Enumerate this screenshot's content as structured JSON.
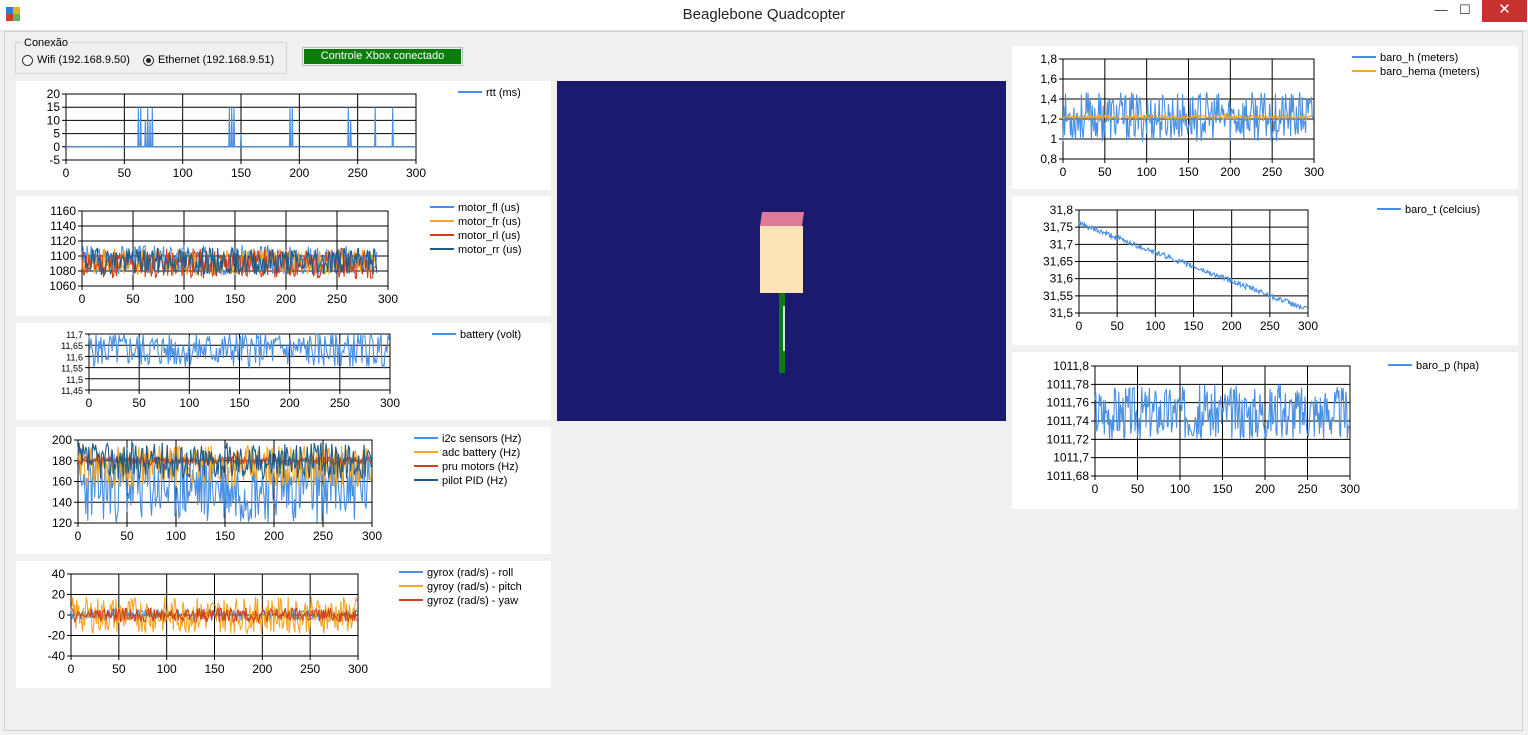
{
  "window": {
    "title": "Beaglebone Quadcopter",
    "minimize_label": "—",
    "maximize_label": "☐",
    "close_label": "✕"
  },
  "connection": {
    "group_label": "Conexão",
    "options": [
      {
        "label": "Wifi (192.168.9.50)",
        "selected": false
      },
      {
        "label": "Ethernet (192.168.9.51)",
        "selected": true
      }
    ]
  },
  "xbox_status": {
    "label": "Controle Xbox conectado",
    "color": "#0a7d0a"
  },
  "colors": {
    "blue": "#4a90e2",
    "orange": "#f5a623",
    "red": "#d0421b",
    "navy": "#1f5c8a"
  },
  "charts": [
    {
      "id": "rtt",
      "x_ticks": [
        "0",
        "50",
        "100",
        "150",
        "200",
        "250",
        "300"
      ],
      "y_ticks": [
        "20",
        "15",
        "10",
        "5",
        "0",
        "-5"
      ],
      "ylim": [
        -5,
        20
      ],
      "legend": [
        "rtt (ms)"
      ],
      "series": [
        {
          "name": "rtt (ms)",
          "color": "#4a90e2",
          "kind": "spikes",
          "base": 0,
          "spikes": [
            [
              62,
              15
            ],
            [
              64,
              15
            ],
            [
              68,
              10
            ],
            [
              70,
              15
            ],
            [
              72,
              10
            ],
            [
              74,
              15
            ],
            [
              140,
              15
            ],
            [
              142,
              15
            ],
            [
              144,
              15
            ],
            [
              150,
              5
            ],
            [
              192,
              15
            ],
            [
              194,
              15
            ],
            [
              242,
              15
            ],
            [
              244,
              10
            ],
            [
              265,
              15
            ],
            [
              280,
              15
            ]
          ]
        }
      ]
    },
    {
      "id": "motors",
      "x_ticks": [
        "0",
        "50",
        "100",
        "150",
        "200",
        "250",
        "300"
      ],
      "y_ticks": [
        "1160",
        "1140",
        "1120",
        "1100",
        "1080",
        "1060"
      ],
      "ylim": [
        1060,
        1160
      ],
      "legend": [
        "motor_fl (us)",
        "motor_fr (us)",
        "motor_rl (us)",
        "motor_rr (us)"
      ],
      "series": [
        {
          "name": "motor_fl (us)",
          "color": "#4a90e2",
          "kind": "noise",
          "mean": 1095,
          "amp": 20,
          "seed": 3,
          "n": 290
        },
        {
          "name": "motor_fr (us)",
          "color": "#f5a623",
          "kind": "noise",
          "mean": 1092,
          "amp": 18,
          "seed": 7,
          "n": 290
        },
        {
          "name": "motor_rl (us)",
          "color": "#d0421b",
          "kind": "noise",
          "mean": 1090,
          "amp": 20,
          "seed": 11,
          "n": 290
        },
        {
          "name": "motor_rr (us)",
          "color": "#1f5c8a",
          "kind": "noise",
          "mean": 1093,
          "amp": 18,
          "seed": 19,
          "n": 290
        }
      ]
    },
    {
      "id": "battery",
      "x_ticks": [
        "0",
        "50",
        "100",
        "150",
        "200",
        "250",
        "300"
      ],
      "y_ticks": [
        "11,7",
        "11,65",
        "11,6",
        "11,55",
        "11,5",
        "11,45"
      ],
      "ylim": [
        11.45,
        11.7
      ],
      "legend": [
        "battery (volt)"
      ],
      "series": [
        {
          "name": "battery (volt)",
          "color": "#4a90e2",
          "kind": "noise",
          "mean": 11.63,
          "amp": 0.08,
          "seed": 5,
          "n": 300
        }
      ]
    },
    {
      "id": "rates",
      "x_ticks": [
        "0",
        "50",
        "100",
        "150",
        "200",
        "250",
        "300"
      ],
      "y_ticks": [
        "200",
        "180",
        "160",
        "140",
        "120"
      ],
      "ylim": [
        120,
        200
      ],
      "legend": [
        "i2c sensors (Hz)",
        "adc battery (Hz)",
        "pru motors (Hz)",
        "pilot PID (Hz)"
      ],
      "series": [
        {
          "name": "i2c sensors (Hz)",
          "color": "#4a90e2",
          "kind": "noise",
          "mean": 155,
          "amp": 35,
          "seed": 23,
          "n": 300
        },
        {
          "name": "adc battery (Hz)",
          "color": "#f5a623",
          "kind": "noise",
          "mean": 175,
          "amp": 20,
          "seed": 29,
          "n": 300
        },
        {
          "name": "pru motors (Hz)",
          "color": "#d0421b",
          "kind": "noise",
          "mean": 180,
          "amp": 4,
          "seed": 31,
          "n": 300
        },
        {
          "name": "pilot PID (Hz)",
          "color": "#1f5c8a",
          "kind": "noise",
          "mean": 180,
          "amp": 18,
          "seed": 37,
          "n": 300
        }
      ]
    },
    {
      "id": "gyro",
      "x_ticks": [
        "0",
        "50",
        "100",
        "150",
        "200",
        "250",
        "300"
      ],
      "y_ticks": [
        "40",
        "20",
        "0",
        "-20",
        "-40"
      ],
      "ylim": [
        -40,
        40
      ],
      "legend": [
        "gyrox (rad/s) - roll",
        "gyroy (rad/s) - pitch",
        "gyroz (rad/s) - yaw"
      ],
      "series": [
        {
          "name": "gyrox (rad/s) - roll",
          "color": "#4a90e2",
          "kind": "noise",
          "mean": 0,
          "amp": 6,
          "seed": 41,
          "n": 300
        },
        {
          "name": "gyroy (rad/s) - pitch",
          "color": "#f5a623",
          "kind": "noise",
          "mean": 0,
          "amp": 18,
          "seed": 43,
          "n": 300
        },
        {
          "name": "gyroz (rad/s) - yaw",
          "color": "#d0421b",
          "kind": "noise",
          "mean": 0,
          "amp": 7,
          "seed": 47,
          "n": 300
        }
      ]
    },
    {
      "id": "baro_h",
      "x_ticks": [
        "0",
        "50",
        "100",
        "150",
        "200",
        "250",
        "300"
      ],
      "y_ticks": [
        "1,8",
        "1,6",
        "1,4",
        "1,2",
        "1",
        "0,8"
      ],
      "ylim": [
        0.8,
        1.8
      ],
      "legend": [
        "baro_h (meters)",
        "baro_hema (meters)"
      ],
      "series": [
        {
          "name": "baro_h (meters)",
          "color": "#4a90e2",
          "kind": "noise",
          "mean": 1.22,
          "amp": 0.25,
          "seed": 53,
          "n": 300
        },
        {
          "name": "baro_hema (meters)",
          "color": "#f5a623",
          "kind": "noise",
          "mean": 1.22,
          "amp": 0.02,
          "seed": 59,
          "n": 300
        }
      ]
    },
    {
      "id": "baro_t",
      "x_ticks": [
        "0",
        "50",
        "100",
        "150",
        "200",
        "250",
        "300"
      ],
      "y_ticks": [
        "31,8",
        "31,75",
        "31,7",
        "31,65",
        "31,6",
        "31,55",
        "31,5"
      ],
      "ylim": [
        31.5,
        31.8
      ],
      "legend": [
        "baro_t (celcius)"
      ],
      "series": [
        {
          "name": "baro_t (celcius)",
          "color": "#4a90e2",
          "kind": "trend",
          "start": 31.76,
          "end": 31.51,
          "amp": 0.008,
          "seed": 61,
          "n": 300
        }
      ]
    },
    {
      "id": "baro_p",
      "x_ticks": [
        "0",
        "50",
        "100",
        "150",
        "200",
        "250",
        "300"
      ],
      "y_ticks": [
        "1011,8",
        "1011,78",
        "1011,76",
        "1011,74",
        "1011,72",
        "1011,7",
        "1011,68"
      ],
      "ylim": [
        1011.68,
        1011.8
      ],
      "legend": [
        "baro_p (hpa)"
      ],
      "series": [
        {
          "name": "baro_p (hpa)",
          "color": "#4a90e2",
          "kind": "noise",
          "mean": 1011.75,
          "amp": 0.03,
          "seed": 67,
          "n": 300
        }
      ]
    }
  ],
  "model3d": {
    "body_color": "#fde4b8",
    "top_color": "#de7a96",
    "stick_color": "#0c7a1a",
    "background": "#1b1a6e"
  }
}
